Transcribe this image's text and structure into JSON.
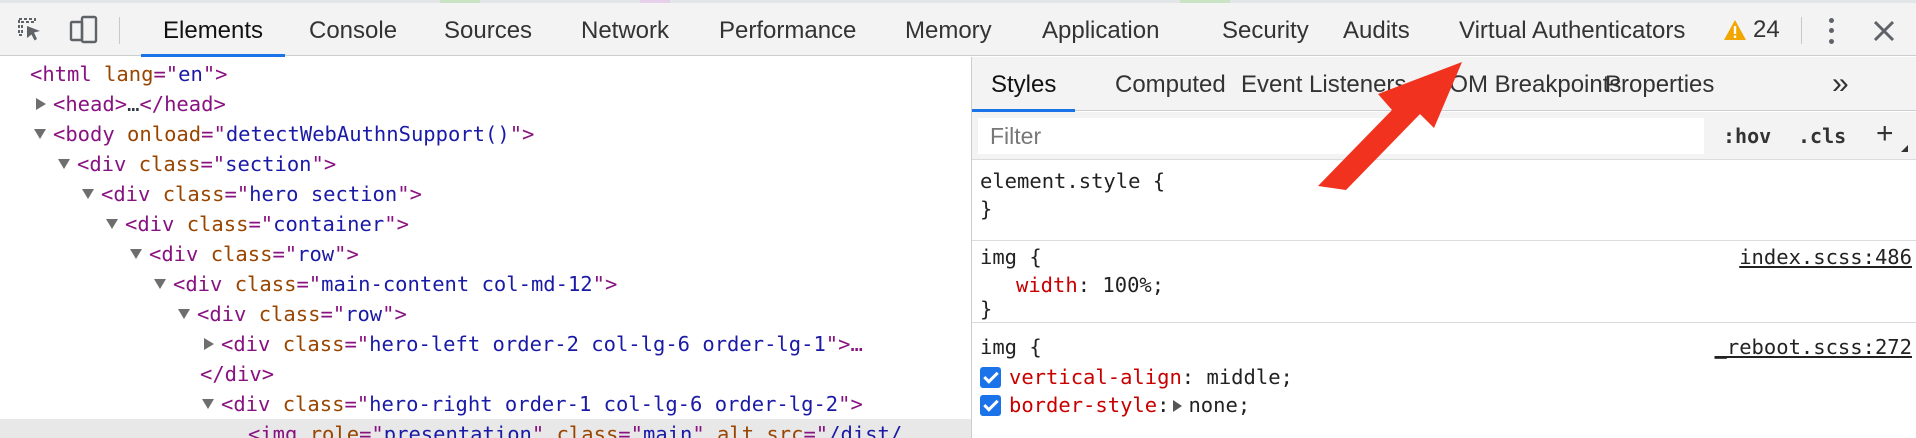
{
  "toolbar": {
    "tabs": [
      "Elements",
      "Console",
      "Sources",
      "Network",
      "Performance",
      "Memory",
      "Application",
      "Security",
      "Audits",
      "Virtual Authenticators"
    ],
    "active_tab": "Elements",
    "warning_count": "24"
  },
  "tree": {
    "lines": [
      {
        "t1": "<html",
        "a1": " lang",
        "v1": "en",
        "t2": ">"
      },
      {
        "t1": "<head>",
        "txt": "…",
        "t2": "</head>"
      },
      {
        "t1": "<body",
        "a1": " onload",
        "v1": "detectWebAuthnSupport()",
        "t2": ">"
      },
      {
        "t1": "<div",
        "a1": " class",
        "v1": "section",
        "t2": ">"
      },
      {
        "t1": "<div",
        "a1": " class",
        "v1": "hero section",
        "t2": ">"
      },
      {
        "t1": "<div",
        "a1": " class",
        "v1": "container",
        "t2": ">"
      },
      {
        "t1": "<div",
        "a1": " class",
        "v1": "row",
        "t2": ">"
      },
      {
        "t1": "<div",
        "a1": " class",
        "v1": "main-content col-md-12",
        "t2": ">"
      },
      {
        "t1": "<div",
        "a1": " class",
        "v1": "row",
        "t2": ">"
      },
      {
        "t1": "<div",
        "a1": " class",
        "v1": "hero-left order-2 col-lg-6 order-lg-1",
        "t2": ">…"
      },
      {
        "t1": "</div>"
      },
      {
        "t1": "<div",
        "a1": " class",
        "v1": "hero-right order-1 col-lg-6 order-lg-2",
        "t2": ">"
      },
      {
        "t1": "<img",
        "a1": " role",
        "v1": "presentation",
        "a2": " class",
        "v2": "main",
        "a3": " alt src",
        "v3": "/dist/"
      }
    ]
  },
  "sidebar": {
    "tabs": [
      "Styles",
      "Computed",
      "Event Listeners",
      "DOM Breakpoints",
      "Properties"
    ],
    "active_tab": "Styles",
    "more_label": "»",
    "filter_placeholder": "Filter",
    "hov_label": ":hov",
    "cls_label": ".cls",
    "add_label": "+",
    "rules": [
      {
        "selector": "element.style {",
        "close": "}"
      },
      {
        "selector": "img {",
        "source": "index.scss:486",
        "props": [
          {
            "name": "width",
            "value": "100%;"
          }
        ],
        "close": "}"
      },
      {
        "selector": "img {",
        "source": "_reboot.scss:272",
        "props": [
          {
            "name": "vertical-align",
            "value": "middle;"
          },
          {
            "name": "border-style",
            "value": "none;"
          }
        ]
      }
    ]
  },
  "colors": {
    "accent": "#1a73e8",
    "annotation_arrow": "#f0321e",
    "warning": "#f2a600"
  }
}
